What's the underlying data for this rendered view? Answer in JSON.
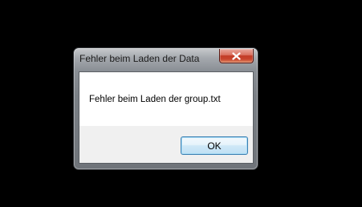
{
  "dialog": {
    "title": "Fehler beim Laden der Data",
    "message": "Fehler beim Laden der group.txt",
    "ok_label": "OK",
    "close_icon": "close-icon"
  },
  "colors": {
    "desktop_background": "#000000",
    "close_button": "#c23b26",
    "ok_button_border": "#3c7fb1"
  }
}
